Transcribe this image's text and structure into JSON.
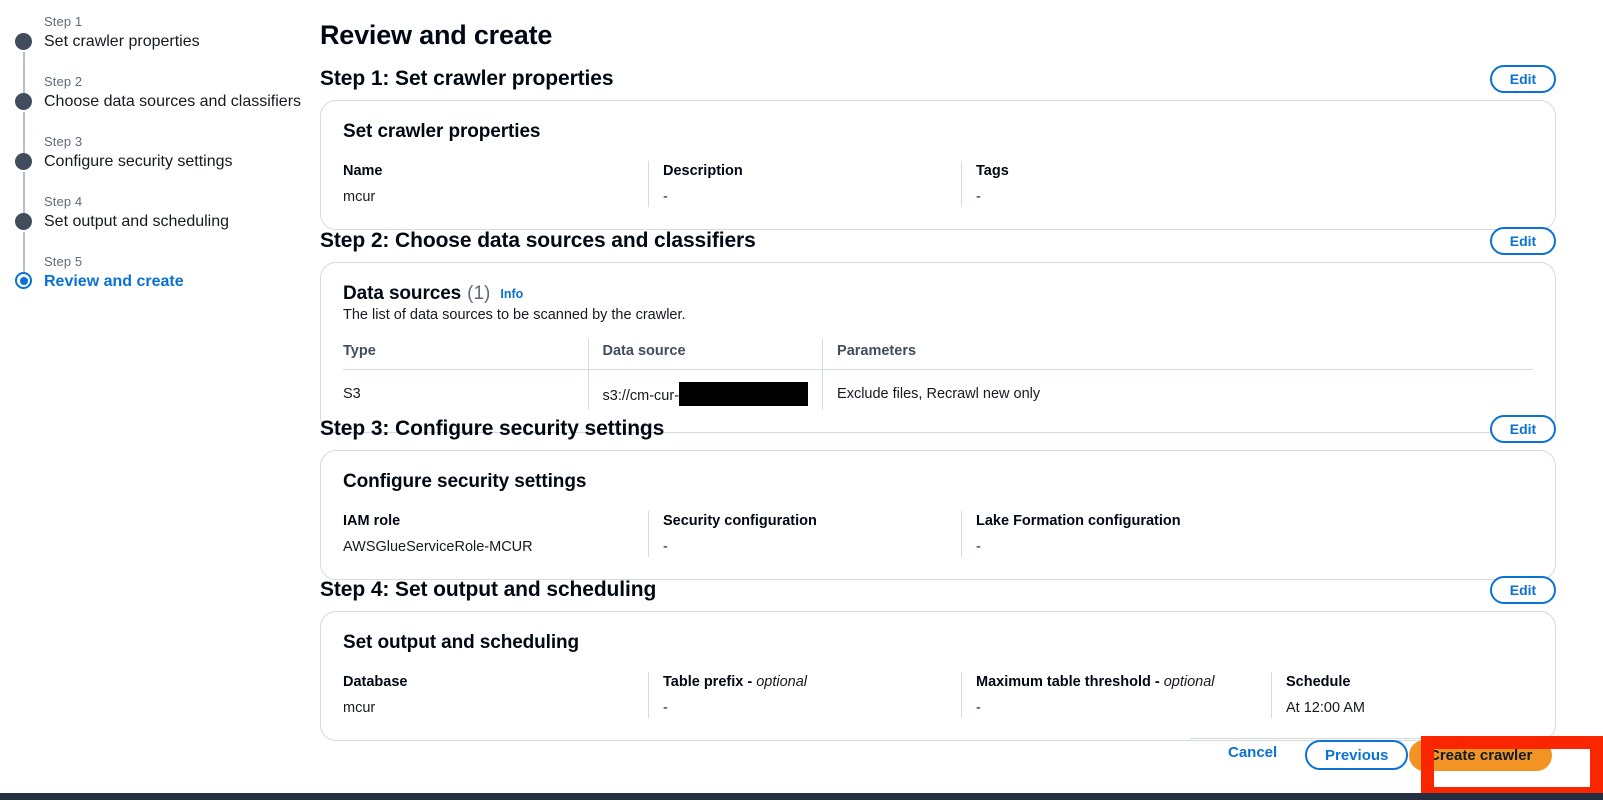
{
  "wizard": {
    "steps": [
      {
        "number": "Step 1",
        "label": "Set crawler properties",
        "state": "done"
      },
      {
        "number": "Step 2",
        "label": "Choose data sources and classifiers",
        "state": "done"
      },
      {
        "number": "Step 3",
        "label": "Configure security settings",
        "state": "done"
      },
      {
        "number": "Step 4",
        "label": "Set output and scheduling",
        "state": "done"
      },
      {
        "number": "Step 5",
        "label": "Review and create",
        "state": "active"
      }
    ]
  },
  "page": {
    "title": "Review and create"
  },
  "sections": [
    {
      "heading": "Step 1: Set crawler properties",
      "edit_label": "Edit",
      "card_title": "Set crawler properties",
      "fields": [
        {
          "key": "Name",
          "value": "mcur"
        },
        {
          "key": "Description",
          "value": "-"
        },
        {
          "key": "Tags",
          "value": "-"
        }
      ]
    },
    {
      "heading": "Step 2: Choose data sources and classifiers",
      "edit_label": "Edit",
      "card_title": "Data sources",
      "card_count": "(1)",
      "info_label": "Info",
      "card_sub": "The list of data sources to be scanned by the crawler.",
      "table": {
        "columns": [
          "Type",
          "Data source",
          "Parameters"
        ],
        "rows": [
          {
            "type": "S3",
            "data_source_prefix": "s3://cm-cur-",
            "data_source_redacted": true,
            "parameters": "Exclude files, Recrawl new only"
          }
        ]
      }
    },
    {
      "heading": "Step 3: Configure security settings",
      "edit_label": "Edit",
      "card_title": "Configure security settings",
      "fields": [
        {
          "key": "IAM role",
          "value": "AWSGlueServiceRole-MCUR"
        },
        {
          "key": "Security configuration",
          "value": "-"
        },
        {
          "key": "Lake Formation configuration",
          "value": "-"
        }
      ]
    },
    {
      "heading": "Step 4: Set output and scheduling",
      "edit_label": "Edit",
      "card_title": "Set output and scheduling",
      "fields": [
        {
          "key": "Database",
          "value": "mcur"
        },
        {
          "key": "Table prefix - ",
          "key_optional": "optional",
          "value": "-"
        },
        {
          "key": "Maximum table threshold - ",
          "key_optional": "optional",
          "value": "-"
        },
        {
          "key": "Schedule",
          "value": "At 12:00 AM"
        }
      ]
    }
  ],
  "footer": {
    "cancel_label": "Cancel",
    "previous_label": "Previous",
    "create_label": "Create crawler"
  },
  "colors": {
    "accent_blue": "#0972d3",
    "button_orange": "#f29423",
    "annotation_red": "#fa2600",
    "bottom_bar": "#232f3e"
  }
}
